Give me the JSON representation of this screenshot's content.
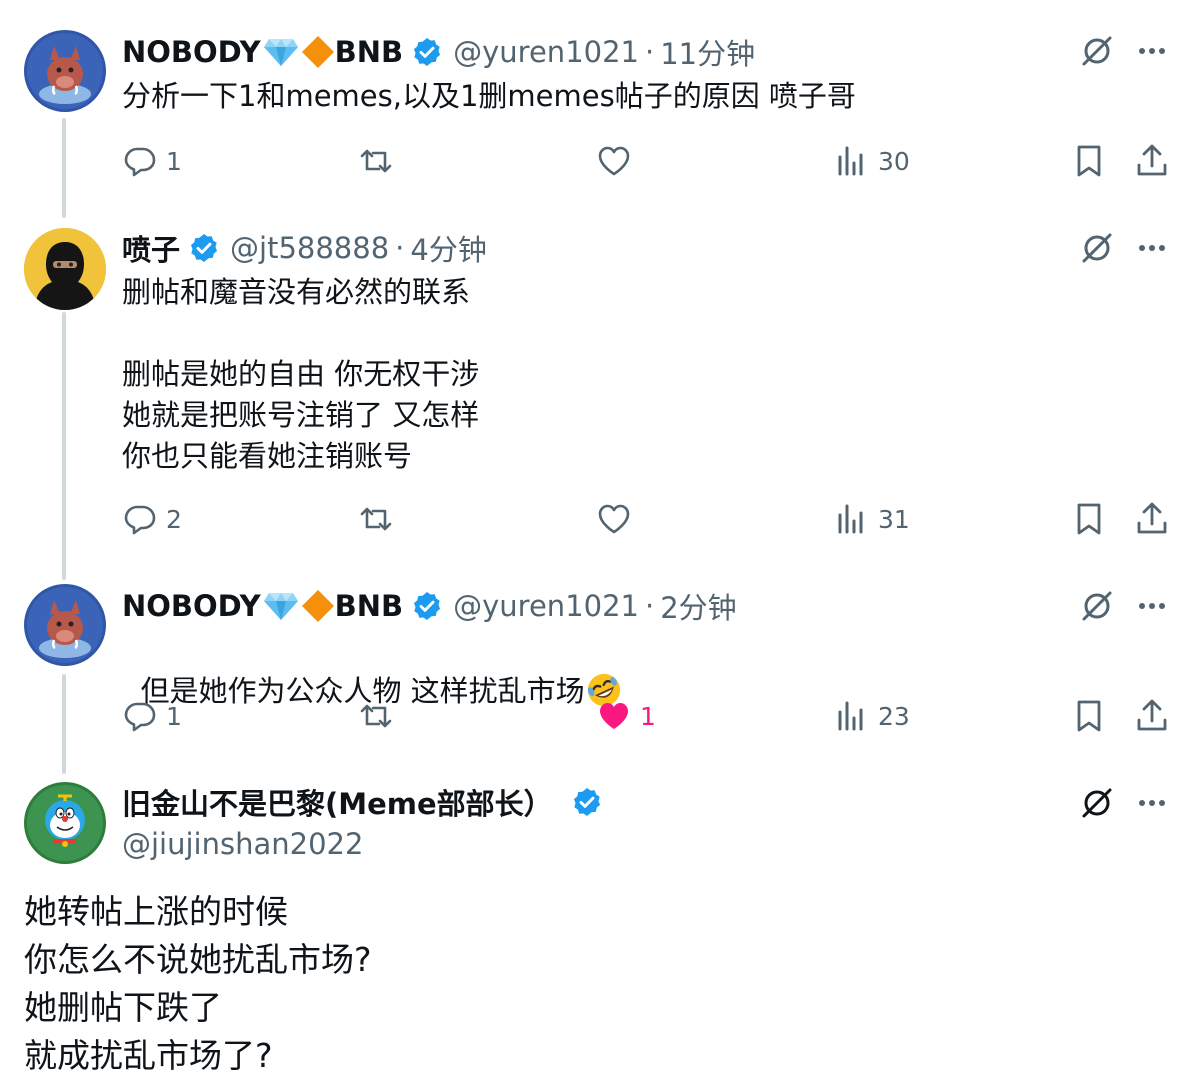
{
  "tweets": [
    {
      "name": "NOBODY",
      "name_suffix": "BNB",
      "handle": "@yuren1021",
      "time": "11分钟",
      "text": "分析一下1和memes,以及1删memes帖子的原因 喷子哥",
      "replies": "1",
      "views": "30",
      "likes": ""
    },
    {
      "name": "喷子",
      "handle": "@jt588888",
      "time": "4分钟",
      "text": "删帖和魔音没有必然的联系\n\n删帖是她的自由 你无权干涉\n她就是把账号注销了 又怎样\n你也只能看她注销账号",
      "replies": "2",
      "views": "31",
      "likes": ""
    },
    {
      "name": "NOBODY",
      "name_suffix": "BNB",
      "handle": "@yuren1021",
      "time": "2分钟",
      "text": "但是她作为公众人物 这样扰乱市场",
      "replies": "1",
      "views": "23",
      "likes": "1"
    },
    {
      "name": "旧金山不是巴黎(Meme部部长）",
      "handle": "@jiujinshan2022",
      "text": "她转帖上涨的时候\n你怎么不说她扰乱市场?\n她删帖下跌了\n就成扰乱市场了?"
    }
  ],
  "separator": "·",
  "colors": {
    "verified": "#1d9bf0",
    "like_active": "#f91880",
    "muted": "#536471",
    "thread_line": "#cfd9de"
  }
}
